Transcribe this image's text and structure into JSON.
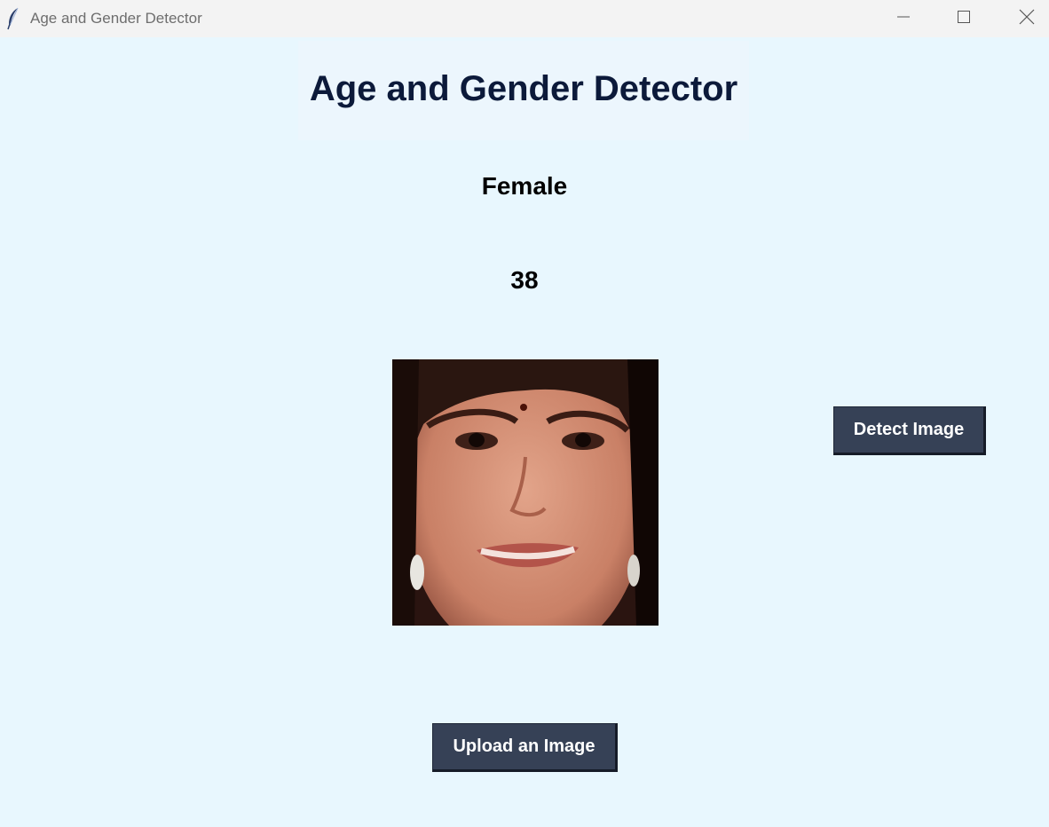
{
  "window": {
    "title": "Age and Gender Detector",
    "app_icon": "feather-icon",
    "controls": [
      "minimize-icon",
      "maximize-icon",
      "close-icon"
    ]
  },
  "main": {
    "heading": "Age and Gender Detector",
    "gender_result": "Female",
    "age_result": "38",
    "image": {
      "icon": "face-photo"
    },
    "buttons": {
      "detect_label": "Detect Image",
      "upload_label": "Upload an Image"
    }
  },
  "colors": {
    "background": "#e8f7fe",
    "heading_text": "#0c1a3a",
    "button_bg": "#364156",
    "button_text": "#ffffff",
    "titlebar_bg": "#f3f3f3"
  }
}
